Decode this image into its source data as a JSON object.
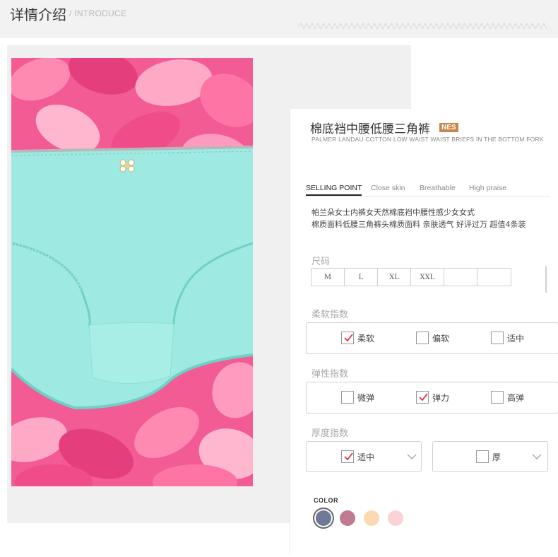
{
  "header": {
    "title": "详情介绍",
    "subtitle": "/ INTRODUCE"
  },
  "product": {
    "title": "棉底裆中腰低腰三角裤",
    "badge": "NES",
    "subtitle": "PALMER LANDAU COTTON LOW WAIST WAIST BRIEFS IN THE BOTTOM FORK",
    "tabs": [
      {
        "label": "SELLING POINT",
        "active": true
      },
      {
        "label": "Close skin",
        "active": false
      },
      {
        "label": "Breathable",
        "active": false
      },
      {
        "label": "High praise",
        "active": false
      }
    ],
    "description": [
      "帕兰朵女士内裤女天然棉底裆中腰性感少女女式",
      "棉质面料低腰三角裤头棉质面料 亲肤透气 好评过万 超值4条装"
    ]
  },
  "size": {
    "label": "尺码",
    "options": [
      "M",
      "L",
      "XL",
      "XXL",
      "",
      ""
    ]
  },
  "softness": {
    "label": "柔软指数",
    "options": [
      {
        "label": "柔软",
        "checked": true
      },
      {
        "label": "偏软",
        "checked": false
      },
      {
        "label": "适中",
        "checked": false
      }
    ]
  },
  "elasticity": {
    "label": "弹性指数",
    "options": [
      {
        "label": "微弹",
        "checked": false
      },
      {
        "label": "弹力",
        "checked": true
      },
      {
        "label": "高弹",
        "checked": false
      }
    ]
  },
  "thickness": {
    "label": "厚度指数",
    "options": [
      {
        "label": "适中",
        "checked": true
      },
      {
        "label": "厚",
        "checked": false
      }
    ]
  },
  "colors": {
    "label": "COLOR",
    "swatches": [
      {
        "name": "slate-blue",
        "hex": "#6e7a96",
        "selected": true
      },
      {
        "name": "mauve",
        "hex": "#c07a92",
        "selected": false
      },
      {
        "name": "peach",
        "hex": "#fcd9b2",
        "selected": false
      },
      {
        "name": "light-pink",
        "hex": "#fbd3d6",
        "selected": false
      }
    ]
  },
  "theme": {
    "check_color": "#e2303b",
    "garment_color": "#9ee9e1",
    "petal_color": "#f25b94"
  }
}
